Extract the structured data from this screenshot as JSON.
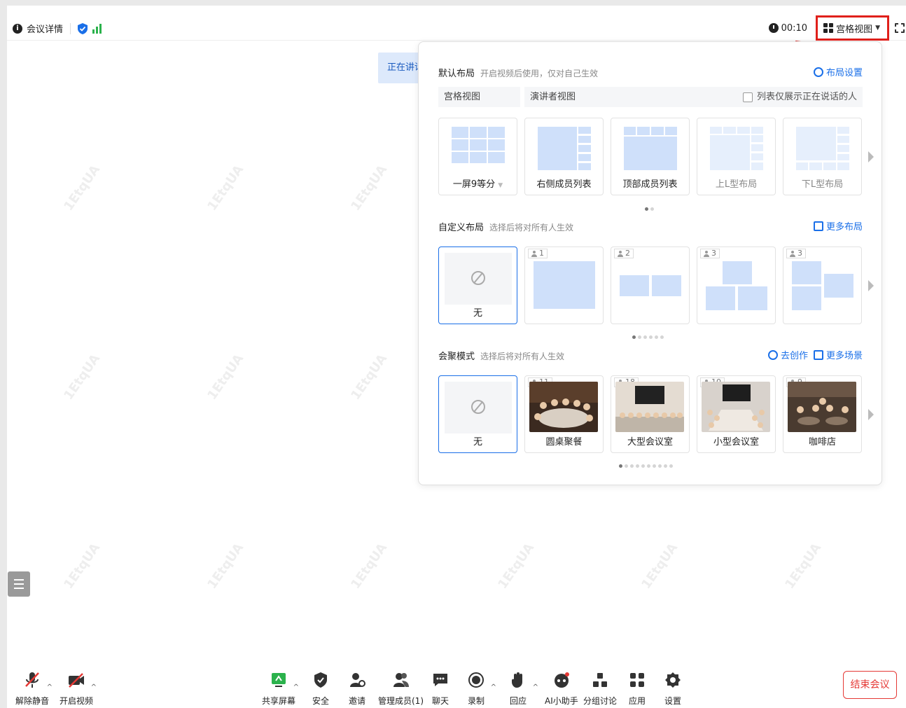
{
  "window": {
    "title": ""
  },
  "topbar": {
    "meeting_details": "会议详情",
    "timer": "00:10",
    "layout_button": "宫格视图"
  },
  "speaking_label": "正在讲话",
  "watermark": "1EtqUA",
  "panel": {
    "default_layout": {
      "title": "默认布局",
      "subtitle": "开启视频后使用，仅对自己生效",
      "settings_link": "布局设置",
      "tabs": [
        "宫格视图",
        "演讲者视图"
      ],
      "only_speaking_checkbox": "列表仅展示正在说话的人",
      "cards": [
        "一屏9等分",
        "右侧成员列表",
        "顶部成员列表",
        "上L型布局",
        "下L型布局"
      ],
      "pages": 2,
      "current_page": 1
    },
    "custom_layout": {
      "title": "自定义布局",
      "subtitle": "选择后将对所有人生效",
      "more_link": "更多布局",
      "cards": [
        {
          "label": "无",
          "count": ""
        },
        {
          "label": "",
          "count": "1"
        },
        {
          "label": "",
          "count": "2"
        },
        {
          "label": "",
          "count": "3"
        },
        {
          "label": "",
          "count": "3"
        }
      ],
      "pages": 6,
      "current_page": 1
    },
    "focus_mode": {
      "title": "会聚模式",
      "subtitle": "选择后将对所有人生效",
      "create_link": "去创作",
      "more_link": "更多场景",
      "cards": [
        {
          "label": "无",
          "count": ""
        },
        {
          "label": "圆桌聚餐",
          "count": "11"
        },
        {
          "label": "大型会议室",
          "count": "18"
        },
        {
          "label": "小型会议室",
          "count": "10"
        },
        {
          "label": "咖啡店",
          "count": "9"
        }
      ],
      "pages": 10,
      "current_page": 1
    }
  },
  "toolbar": {
    "unmute": "解除静音",
    "start_video": "开启视频",
    "share_screen": "共享屏幕",
    "security": "安全",
    "invite": "邀请",
    "manage_members": "管理成员(1)",
    "chat": "聊天",
    "record": "录制",
    "react": "回应",
    "ai_assistant": "AI小助手",
    "breakout": "分组讨论",
    "apps": "应用",
    "settings": "设置",
    "end_meeting": "结束会议"
  },
  "colors": {
    "accent": "#1a6fe8",
    "highlight_red": "#e0201b",
    "end_red": "#e53935",
    "speaking_bg": "#dde9fb",
    "thumb_blue": "#cfe0fa"
  }
}
